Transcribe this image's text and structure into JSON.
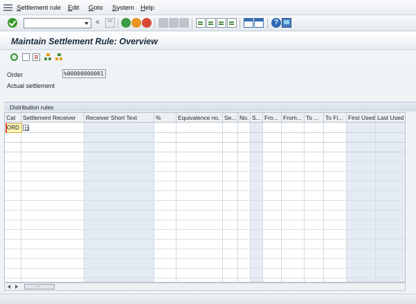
{
  "menu": {
    "items": [
      "Settlement rule",
      "Edit",
      "Goto",
      "System",
      "Help"
    ]
  },
  "toolbar": {
    "command_field_value": "",
    "icons": [
      "check-icon",
      "save-icon",
      "back-icon",
      "exit-icon",
      "cancel-icon",
      "print-icon",
      "find-icon",
      "find-next-icon",
      "first-page-icon",
      "previous-page-icon",
      "next-page-icon",
      "last-page-icon",
      "create-session-icon",
      "shortcut-icon",
      "help-icon",
      "customize-layout-icon"
    ]
  },
  "title": "Maintain Settlement Rule: Overview",
  "app_toolbar": {
    "icons": [
      "overview-icon",
      "create-icon",
      "list-icon",
      "hierarchy-icon",
      "hierarchy-2-icon"
    ]
  },
  "header": {
    "order_label": "Order",
    "order_value": "%00000000001",
    "actual_settlement_label": "Actual settlement"
  },
  "distribution_rules": {
    "title": "Distribution rules",
    "columns": [
      "Cat",
      "Settlement Receiver",
      "Receiver Short Text",
      "%",
      "Equivalence no.",
      "Se...",
      "No.",
      "S...",
      "Fro...",
      "From...",
      "To ...",
      "To Fi...",
      "First Used",
      "Last Used"
    ],
    "rows": [
      {
        "cat": "ORD"
      }
    ]
  },
  "colors": {
    "accent": "#2d69b5",
    "highlight_cell": "#fdf6b8",
    "shaded_column": "#e4ebf2"
  }
}
